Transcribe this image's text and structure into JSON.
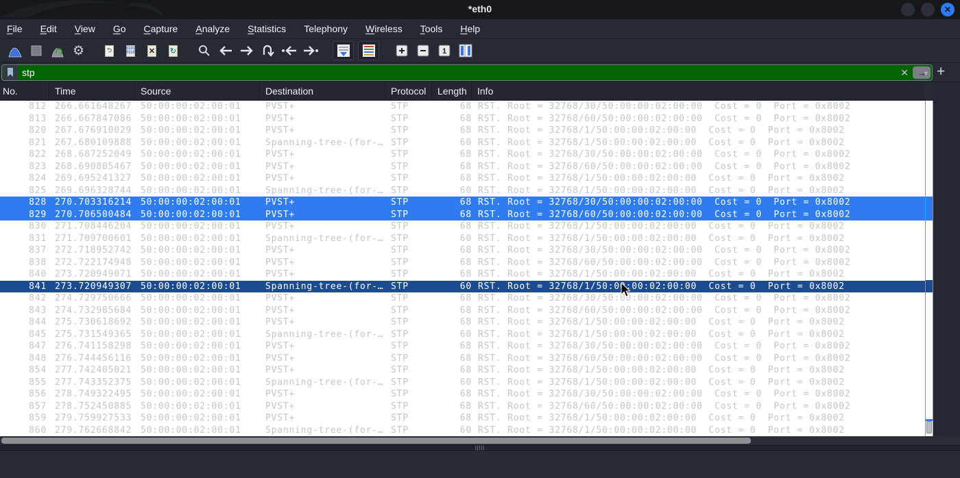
{
  "window": {
    "title": "*eth0"
  },
  "menu": {
    "items": [
      {
        "label": "File",
        "underline_first": true
      },
      {
        "label": "Edit",
        "underline_first": true
      },
      {
        "label": "View",
        "underline_first": true
      },
      {
        "label": "Go",
        "underline_first": true
      },
      {
        "label": "Capture",
        "underline_first": true
      },
      {
        "label": "Analyze",
        "underline_first": true
      },
      {
        "label": "Statistics",
        "underline_first": true
      },
      {
        "label": "Telephony",
        "underline_first": false
      },
      {
        "label": "Wireless",
        "underline_first": true
      },
      {
        "label": "Tools",
        "underline_first": true
      },
      {
        "label": "Help",
        "underline_first": true
      }
    ]
  },
  "toolbar": {
    "groups": [
      [
        "start-capture",
        "stop-capture",
        "restart-capture",
        "capture-options"
      ],
      [
        "open-file",
        "save-file",
        "close-file",
        "reload-file"
      ],
      [
        "find-packet",
        "go-back",
        "go-forward",
        "go-to-packet",
        "go-first-packet",
        "go-last-packet"
      ],
      [
        "auto-scroll",
        "colorize-packets"
      ],
      [
        "zoom-in",
        "zoom-out",
        "zoom-original",
        "resize-columns"
      ]
    ]
  },
  "filter": {
    "value": "stp",
    "clear_label": "✕",
    "apply_label": "→",
    "dropdown_caret": "▼",
    "add_button_label": "+",
    "valid_color": "#016301"
  },
  "columns": [
    "No.",
    "Time",
    "Source",
    "Destination",
    "Protocol",
    "Length",
    "Info"
  ],
  "rows": [
    {
      "no": "812",
      "time": "266.661648267",
      "src": "50:00:00:02:00:01",
      "dst": "PVST+",
      "proto": "STP",
      "len": "68",
      "info": "RST. Root = 32768/30/50:00:00:02:00:00  Cost = 0  Port = 0x8002",
      "state": "normal"
    },
    {
      "no": "813",
      "time": "266.667847086",
      "src": "50:00:00:02:00:01",
      "dst": "PVST+",
      "proto": "STP",
      "len": "68",
      "info": "RST. Root = 32768/60/50:00:00:02:00:00  Cost = 0  Port = 0x8002",
      "state": "normal"
    },
    {
      "no": "820",
      "time": "267.676910029",
      "src": "50:00:00:02:00:01",
      "dst": "PVST+",
      "proto": "STP",
      "len": "68",
      "info": "RST. Root = 32768/1/50:00:00:02:00:00  Cost = 0  Port = 0x8002",
      "state": "normal"
    },
    {
      "no": "821",
      "time": "267.680109888",
      "src": "50:00:00:02:00:01",
      "dst": "Spanning-tree-(for-…",
      "proto": "STP",
      "len": "60",
      "info": "RST. Root = 32768/1/50:00:00:02:00:00  Cost = 0  Port = 0x8002",
      "state": "normal"
    },
    {
      "no": "822",
      "time": "268.687252049",
      "src": "50:00:00:02:00:01",
      "dst": "PVST+",
      "proto": "STP",
      "len": "68",
      "info": "RST. Root = 32768/30/50:00:00:02:00:00  Cost = 0  Port = 0x8002",
      "state": "normal"
    },
    {
      "no": "823",
      "time": "268.690805467",
      "src": "50:00:00:02:00:01",
      "dst": "PVST+",
      "proto": "STP",
      "len": "68",
      "info": "RST. Root = 32768/60/50:00:00:02:00:00  Cost = 0  Port = 0x8002",
      "state": "normal"
    },
    {
      "no": "824",
      "time": "269.695241327",
      "src": "50:00:00:02:00:01",
      "dst": "PVST+",
      "proto": "STP",
      "len": "68",
      "info": "RST. Root = 32768/1/50:00:00:02:00:00  Cost = 0  Port = 0x8002",
      "state": "normal"
    },
    {
      "no": "825",
      "time": "269.696328744",
      "src": "50:00:00:02:00:01",
      "dst": "Spanning-tree-(for-…",
      "proto": "STP",
      "len": "60",
      "info": "RST. Root = 32768/1/50:00:00:02:00:00  Cost = 0  Port = 0x8002",
      "state": "normal"
    },
    {
      "no": "828",
      "time": "270.703316214",
      "src": "50:00:00:02:00:01",
      "dst": "PVST+",
      "proto": "STP",
      "len": "68",
      "info": "RST. Root = 32768/30/50:00:00:02:00:00  Cost = 0  Port = 0x8002",
      "state": "selected"
    },
    {
      "no": "829",
      "time": "270.706500484",
      "src": "50:00:00:02:00:01",
      "dst": "PVST+",
      "proto": "STP",
      "len": "68",
      "info": "RST. Root = 32768/60/50:00:00:02:00:00  Cost = 0  Port = 0x8002",
      "state": "selected"
    },
    {
      "no": "830",
      "time": "271.708446204",
      "src": "50:00:00:02:00:01",
      "dst": "PVST+",
      "proto": "STP",
      "len": "68",
      "info": "RST. Root = 32768/1/50:00:00:02:00:00  Cost = 0  Port = 0x8002",
      "state": "normal"
    },
    {
      "no": "831",
      "time": "271.709700601",
      "src": "50:00:00:02:00:01",
      "dst": "Spanning-tree-(for-…",
      "proto": "STP",
      "len": "60",
      "info": "RST. Root = 32768/1/50:00:00:02:00:00  Cost = 0  Port = 0x8002",
      "state": "normal"
    },
    {
      "no": "837",
      "time": "272.718952742",
      "src": "50:00:00:02:00:01",
      "dst": "PVST+",
      "proto": "STP",
      "len": "68",
      "info": "RST. Root = 32768/30/50:00:00:02:00:00  Cost = 0  Port = 0x8002",
      "state": "normal"
    },
    {
      "no": "838",
      "time": "272.722174948",
      "src": "50:00:00:02:00:01",
      "dst": "PVST+",
      "proto": "STP",
      "len": "68",
      "info": "RST. Root = 32768/60/50:00:00:02:00:00  Cost = 0  Port = 0x8002",
      "state": "normal"
    },
    {
      "no": "840",
      "time": "273.720949071",
      "src": "50:00:00:02:00:01",
      "dst": "PVST+",
      "proto": "STP",
      "len": "68",
      "info": "RST. Root = 32768/1/50:00:00:02:00:00  Cost = 0  Port = 0x8002",
      "state": "normal"
    },
    {
      "no": "841",
      "time": "273.720949307",
      "src": "50:00:00:02:00:01",
      "dst": "Spanning-tree-(for-…",
      "proto": "STP",
      "len": "60",
      "info": "RST. Root = 32768/1/50:00:00:02:00:00  Cost = 0  Port = 0x8002",
      "state": "focused"
    },
    {
      "no": "842",
      "time": "274.729750666",
      "src": "50:00:00:02:00:01",
      "dst": "PVST+",
      "proto": "STP",
      "len": "68",
      "info": "RST. Root = 32768/30/50:00:00:02:00:00  Cost = 0  Port = 0x8002",
      "state": "normal"
    },
    {
      "no": "843",
      "time": "274.732985684",
      "src": "50:00:00:02:00:01",
      "dst": "PVST+",
      "proto": "STP",
      "len": "68",
      "info": "RST. Root = 32768/60/50:00:00:02:00:00  Cost = 0  Port = 0x8002",
      "state": "normal"
    },
    {
      "no": "844",
      "time": "275.730618692",
      "src": "50:00:00:02:00:01",
      "dst": "PVST+",
      "proto": "STP",
      "len": "68",
      "info": "RST. Root = 32768/1/50:00:00:02:00:00  Cost = 0  Port = 0x8002",
      "state": "normal"
    },
    {
      "no": "845",
      "time": "275.731549365",
      "src": "50:00:00:02:00:01",
      "dst": "Spanning-tree-(for-…",
      "proto": "STP",
      "len": "60",
      "info": "RST. Root = 32768/1/50:00:00:02:00:00  Cost = 0  Port = 0x8002",
      "state": "normal"
    },
    {
      "no": "847",
      "time": "276.741158298",
      "src": "50:00:00:02:00:01",
      "dst": "PVST+",
      "proto": "STP",
      "len": "68",
      "info": "RST. Root = 32768/30/50:00:00:02:00:00  Cost = 0  Port = 0x8002",
      "state": "normal"
    },
    {
      "no": "848",
      "time": "276.744456116",
      "src": "50:00:00:02:00:01",
      "dst": "PVST+",
      "proto": "STP",
      "len": "68",
      "info": "RST. Root = 32768/60/50:00:00:02:00:00  Cost = 0  Port = 0x8002",
      "state": "normal"
    },
    {
      "no": "854",
      "time": "277.742405021",
      "src": "50:00:00:02:00:01",
      "dst": "PVST+",
      "proto": "STP",
      "len": "68",
      "info": "RST. Root = 32768/1/50:00:00:02:00:00  Cost = 0  Port = 0x8002",
      "state": "normal"
    },
    {
      "no": "855",
      "time": "277.743352375",
      "src": "50:00:00:02:00:01",
      "dst": "Spanning-tree-(for-…",
      "proto": "STP",
      "len": "60",
      "info": "RST. Root = 32768/1/50:00:00:02:00:00  Cost = 0  Port = 0x8002",
      "state": "normal"
    },
    {
      "no": "856",
      "time": "278.749322495",
      "src": "50:00:00:02:00:01",
      "dst": "PVST+",
      "proto": "STP",
      "len": "68",
      "info": "RST. Root = 32768/30/50:00:00:02:00:00  Cost = 0  Port = 0x8002",
      "state": "normal"
    },
    {
      "no": "857",
      "time": "278.752450885",
      "src": "50:00:00:02:00:01",
      "dst": "PVST+",
      "proto": "STP",
      "len": "68",
      "info": "RST. Root = 32768/60/50:00:00:02:00:00  Cost = 0  Port = 0x8002",
      "state": "normal"
    },
    {
      "no": "859",
      "time": "279.759927533",
      "src": "50:00:00:02:00:01",
      "dst": "PVST+",
      "proto": "STP",
      "len": "68",
      "info": "RST. Root = 32768/1/50:00:00:02:00:00  Cost = 0  Port = 0x8002",
      "state": "normal"
    },
    {
      "no": "860",
      "time": "279.762668842",
      "src": "50:00:00:02:00:01",
      "dst": "Spanning-tree-(for-…",
      "proto": "STP",
      "len": "60",
      "info": "RST. Root = 32768/1/50:00:00:02:00:00  Cost = 0  Port = 0x8002",
      "state": "normal"
    }
  ],
  "colors": {
    "selected_row": "#2e7cf0",
    "focused_row": "#1c4b8f",
    "normal_row_text": "#c3c6c6",
    "filter_valid_bg": "#016301",
    "chrome_bg": "#262a33"
  }
}
